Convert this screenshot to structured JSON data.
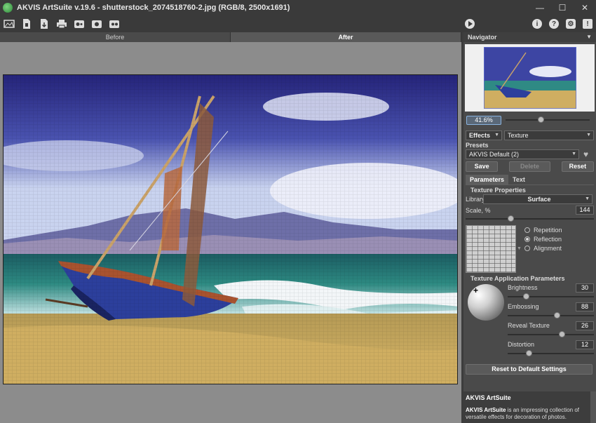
{
  "window": {
    "title": "AKVIS ArtSuite v.19.6 - shutterstock_2074518760-2.jpg (RGB/8, 2500x1691)"
  },
  "tabs": {
    "before": "Before",
    "after": "After"
  },
  "navigator": {
    "title": "Navigator",
    "zoom": "41.6%",
    "zoom_slider_fraction": 0.46
  },
  "effects": {
    "label": "Effects",
    "selected": "Texture"
  },
  "presets": {
    "title": "Presets",
    "selected": "AKVIS Default (2)",
    "save": "Save",
    "delete": "Delete",
    "reset": "Reset"
  },
  "subtabs": {
    "parameters": "Parameters",
    "text": "Text"
  },
  "texture_properties": {
    "title": "Texture Properties",
    "library_label": "Library",
    "library_value": "Surface",
    "scale_label": "Scale, %",
    "scale_value": "144",
    "options": [
      "Repetition",
      "Reflection",
      "Alignment"
    ],
    "selected_option": "Reflection"
  },
  "application": {
    "title": "Texture Application Parameters",
    "brightness_label": "Brightness",
    "brightness_value": "30",
    "embossing_label": "Embossing",
    "embossing_value": "88",
    "reveal_label": "Reveal Texture",
    "reveal_value": "26",
    "distortion_label": "Distortion",
    "distortion_value": "12"
  },
  "reset_defaults": "Reset to Default Settings",
  "info": {
    "title": "AKVIS ArtSuite",
    "brand": "AKVIS ArtSuite",
    "text": " is an impressing collection of versatile effects for decoration of photos."
  },
  "colors": {
    "accent": "#8ab4e0",
    "panel": "#4a4a4a",
    "toolbar": "#3a3a3a"
  }
}
